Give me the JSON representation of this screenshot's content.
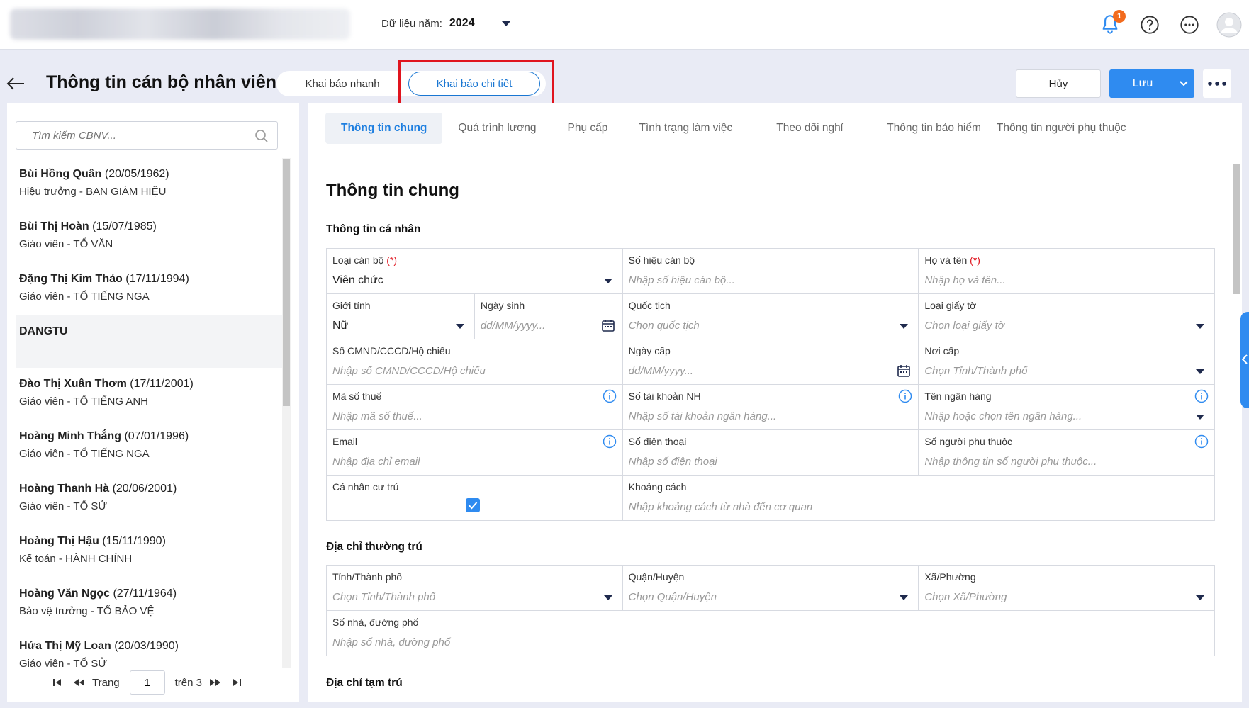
{
  "header": {
    "year_label": "Dữ liệu năm:",
    "year_value": "2024",
    "notification_count": "1",
    "icons": [
      "bell-icon",
      "help-icon",
      "more-horizontal-icon",
      "avatar-icon"
    ]
  },
  "page": {
    "title": "Thông tin cán bộ nhân viên",
    "mode_quick": "Khai báo nhanh",
    "mode_detail": "Khai báo chi tiết",
    "cancel_label": "Hủy",
    "save_label": "Lưu"
  },
  "left": {
    "search_placeholder": "Tìm kiếm CBNV...",
    "employees": [
      {
        "name": "Bùi Hồng Quân",
        "dob": "(20/05/1962)",
        "role": "Hiệu trưởng - BAN GIÁM HIỆU"
      },
      {
        "name": "Bùi Thị Hoàn",
        "dob": "(15/07/1985)",
        "role": "Giáo viên - TỔ VĂN"
      },
      {
        "name": "Đặng Thị Kim Thảo",
        "dob": "(17/11/1994)",
        "role": "Giáo viên - TỔ TIẾNG NGA"
      },
      {
        "name": "DANGTU",
        "dob": "",
        "role": ""
      },
      {
        "name": "Đào Thị Xuân Thơm",
        "dob": "(17/11/2001)",
        "role": "Giáo viên - TỔ TIẾNG ANH"
      },
      {
        "name": "Hoàng Minh Thắng",
        "dob": "(07/01/1996)",
        "role": "Giáo viên - TỔ TIẾNG NGA"
      },
      {
        "name": "Hoàng Thanh Hà",
        "dob": "(20/06/2001)",
        "role": "Giáo viên - TỔ SỬ"
      },
      {
        "name": "Hoàng Thị Hậu",
        "dob": "(15/11/1990)",
        "role": "Kế toán - HÀNH CHÍNH"
      },
      {
        "name": "Hoàng Văn Ngọc",
        "dob": "(27/11/1964)",
        "role": "Bảo vệ trưởng - TỔ BẢO VỆ"
      },
      {
        "name": "Hứa Thị Mỹ Loan",
        "dob": "(20/03/1990)",
        "role": "Giáo viên - TỔ SỬ"
      }
    ],
    "pager": {
      "page_label": "Trang",
      "page": "1",
      "of_label": "trên 3"
    }
  },
  "tabs": [
    "Thông tin chung",
    "Quá trình lương",
    "Phụ cấp",
    "Tình trạng làm việc",
    "Theo dõi nghỉ",
    "Thông tin bảo hiểm",
    "Thông tin người phụ thuộc"
  ],
  "form": {
    "title": "Thông tin chung",
    "personal": {
      "heading": "Thông tin cá nhân",
      "loai_can_bo": {
        "label": "Loại cán bộ",
        "req": "(*)",
        "value": "Viên chức"
      },
      "so_hieu": {
        "label": "Số hiệu cán bộ",
        "placeholder": "Nhập số hiệu cán bộ..."
      },
      "ho_ten": {
        "label": "Họ và tên",
        "req": "(*)",
        "placeholder": "Nhập họ và tên..."
      },
      "gioi_tinh": {
        "label": "Giới tính",
        "value": "Nữ"
      },
      "ngay_sinh": {
        "label": "Ngày sinh",
        "placeholder": "dd/MM/yyyy..."
      },
      "quoc_tich": {
        "label": "Quốc tịch",
        "placeholder": "Chọn quốc tịch"
      },
      "loai_giay_to": {
        "label": "Loại giấy tờ",
        "placeholder": "Chọn loại giấy tờ"
      },
      "so_cmnd": {
        "label": "Số CMND/CCCD/Hộ chiếu",
        "placeholder": "Nhập số CMND/CCCD/Hộ chiếu"
      },
      "ngay_cap": {
        "label": "Ngày cấp",
        "placeholder": "dd/MM/yyyy..."
      },
      "noi_cap": {
        "label": "Nơi cấp",
        "placeholder": "Chọn Tỉnh/Thành phố"
      },
      "ma_so_thue": {
        "label": "Mã số thuế",
        "placeholder": "Nhập mã số thuế..."
      },
      "so_tk": {
        "label": "Số tài khoản NH",
        "placeholder": "Nhập số tài khoản ngân hàng..."
      },
      "ngan_hang": {
        "label": "Tên ngân hàng",
        "placeholder": "Nhập hoặc chọn tên ngân hàng..."
      },
      "email": {
        "label": "Email",
        "placeholder": "Nhập địa chỉ email"
      },
      "sdt": {
        "label": "Số điện thoại",
        "placeholder": "Nhập số điện thoại"
      },
      "nguoi_phu_thuoc": {
        "label": "Số người phụ thuộc",
        "placeholder": "Nhập thông tin số người phụ thuộc..."
      },
      "cu_tru": {
        "label": "Cá nhân cư trú",
        "checked": true
      },
      "khoang_cach": {
        "label": "Khoảng cách",
        "placeholder": "Nhập khoảng cách từ nhà đến cơ quan"
      }
    },
    "permanent": {
      "heading": "Địa chỉ thường trú",
      "tinh": {
        "label": "Tỉnh/Thành phố",
        "placeholder": "Chọn Tỉnh/Thành phố"
      },
      "huyen": {
        "label": "Quận/Huyện",
        "placeholder": "Chọn Quận/Huyện"
      },
      "xa": {
        "label": "Xã/Phường",
        "placeholder": "Chọn Xã/Phường"
      },
      "so_nha": {
        "label": "Số nhà, đường phố",
        "placeholder": "Nhập số nhà, đường phố"
      }
    },
    "temporary": {
      "heading": "Địa chỉ tạm trú"
    }
  },
  "colors": {
    "accent": "#2f8bf0",
    "highlight": "#e0141e",
    "badge": "#f26b1d"
  }
}
